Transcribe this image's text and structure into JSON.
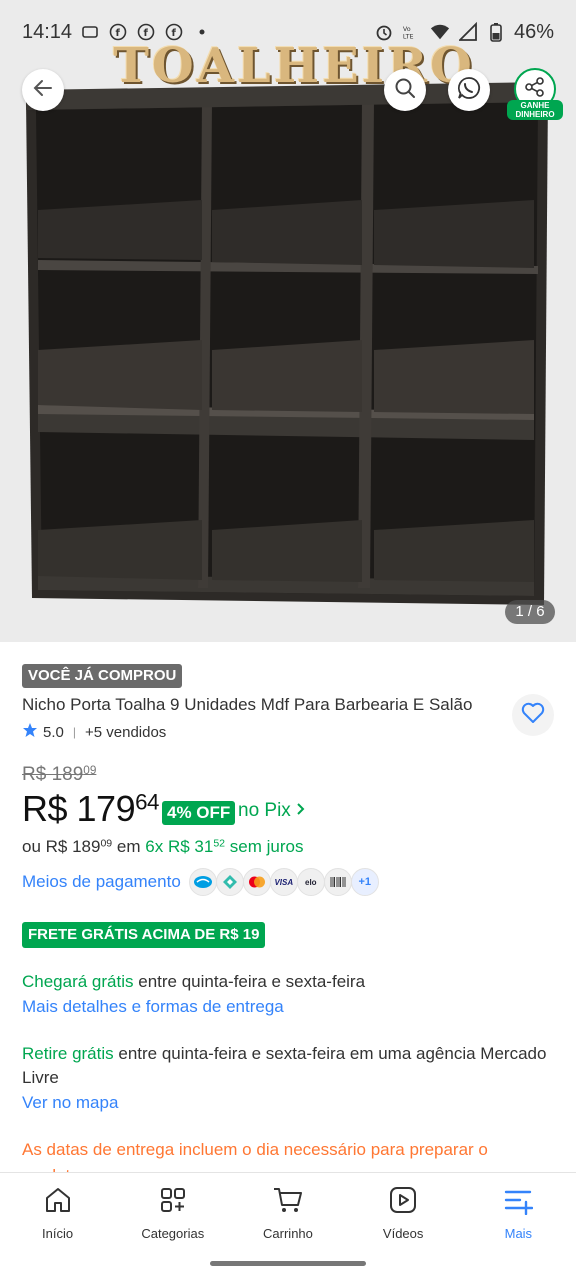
{
  "status_bar": {
    "time": "14:14",
    "battery": "46%"
  },
  "gallery": {
    "sign_text": "TOALHEIRO",
    "counter": "1 / 6",
    "share_label": "GANHE DINHEIRO",
    "shelf_color": "#2d2a27"
  },
  "product": {
    "badge": "VOCÊ JÁ COMPROU",
    "title": "Nicho Porta Toalha 9 Unidades Mdf Para Barbearia E Salão",
    "rating": "5.0",
    "sold": "+5 vendidos",
    "old_price_int": "R$ 189",
    "old_price_cents": "09",
    "price_int": "R$ 179",
    "price_cents": "64",
    "off_badge": "4% OFF",
    "pix_text": "no Pix",
    "installments_prefix": "ou R$ 189",
    "installments_prefix_cents": "09",
    "installments_mid": "em",
    "installments_value": "6x R$ 31",
    "installments_value_cents": "52",
    "installments_suffix": "sem juros"
  },
  "payments": {
    "label": "Meios de pagamento",
    "methods": [
      "mercado-pago",
      "pix",
      "mastercard",
      "VISA",
      "elo",
      "boleto"
    ],
    "more": "+1"
  },
  "shipping": {
    "free_badge": "FRETE GRÁTIS ACIMA DE R$ 19",
    "arrive_green": "Chegará grátis",
    "arrive_rest": "entre quinta-feira e sexta-feira",
    "arrive_link": "Mais detalhes e formas de entrega",
    "pickup_green": "Retire grátis",
    "pickup_rest": "entre quinta-feira e sexta-feira em uma agência Mercado Livre",
    "pickup_link": "Ver no mapa",
    "warning": "As datas de entrega incluem o dia necessário para preparar o produto."
  },
  "nav": {
    "items": [
      {
        "label": "Início",
        "icon": "home-icon"
      },
      {
        "label": "Categorias",
        "icon": "categories-icon"
      },
      {
        "label": "Carrinho",
        "icon": "cart-icon"
      },
      {
        "label": "Vídeos",
        "icon": "video-icon"
      },
      {
        "label": "Mais",
        "icon": "more-menu-icon"
      }
    ],
    "active_color": "#3483fa"
  },
  "colors": {
    "green": "#00a650",
    "blue": "#3483fa",
    "orange": "#ff7733"
  }
}
